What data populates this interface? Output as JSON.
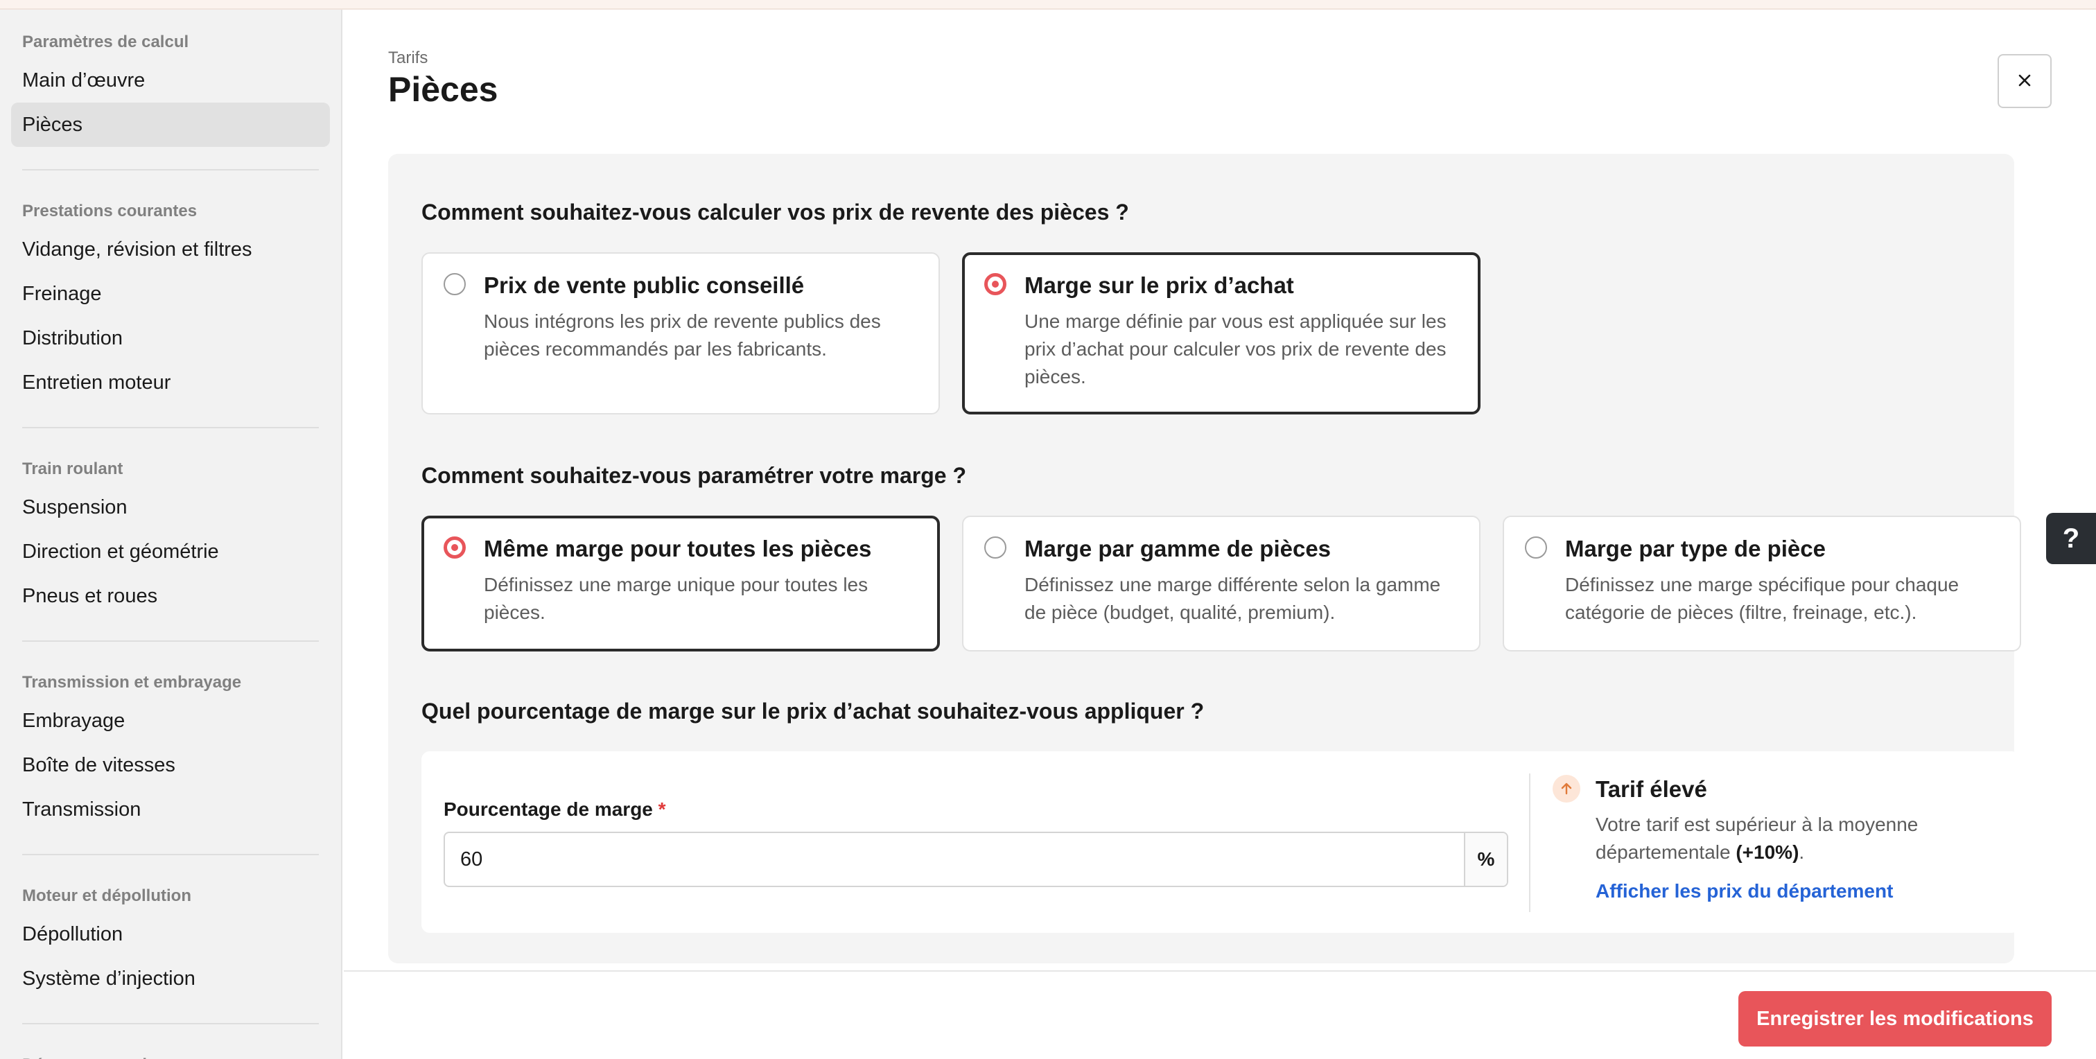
{
  "sidebar": {
    "groups": [
      {
        "title": "Paramètres de calcul",
        "items": [
          "Main d’œuvre",
          "Pièces"
        ]
      },
      {
        "title": "Prestations courantes",
        "items": [
          "Vidange, révision et filtres",
          "Freinage",
          "Distribution",
          "Entretien moteur"
        ]
      },
      {
        "title": "Train roulant",
        "items": [
          "Suspension",
          "Direction et géométrie",
          "Pneus et roues"
        ]
      },
      {
        "title": "Transmission et embrayage",
        "items": [
          "Embrayage",
          "Boîte de vitesses",
          "Transmission"
        ]
      },
      {
        "title": "Moteur et dépollution",
        "items": [
          "Dépollution",
          "Système d’injection"
        ]
      },
      {
        "title": "Démarrage et charge",
        "items": []
      }
    ],
    "active_item": "Pièces"
  },
  "header": {
    "breadcrumb": "Tarifs",
    "title": "Pièces",
    "close_icon": "close-icon"
  },
  "pricing": {
    "question": "Comment souhaitez-vous calculer vos prix de revente des pièces ?",
    "options": [
      {
        "title": "Prix de vente public conseillé",
        "desc": "Nous intégrons les prix de revente publics des pièces recommandés par les fabricants.",
        "selected": false
      },
      {
        "title": "Marge sur le prix d’achat",
        "desc": "Une marge définie par vous est appliquée sur les prix d’achat pour calculer vos prix de revente des pièces.",
        "selected": true
      }
    ]
  },
  "margin_mode": {
    "question": "Comment souhaitez-vous paramétrer votre marge ?",
    "options": [
      {
        "title": "Même marge pour toutes les pièces",
        "desc": "Définissez une marge unique pour toutes les pièces.",
        "selected": true
      },
      {
        "title": "Marge par gamme de pièces",
        "desc": "Définissez une marge différente selon la gamme de pièce (budget, qualité, premium).",
        "selected": false
      },
      {
        "title": "Marge par type de pièce",
        "desc": "Définissez une marge spécifique pour chaque catégorie de pièces (filtre, freinage, etc.).",
        "selected": false
      }
    ]
  },
  "margin_value": {
    "question": "Quel pourcentage de marge sur le prix d’achat souhaitez-vous appliquer ?",
    "label": "Pourcentage de marge",
    "required_mark": "*",
    "value": "60",
    "suffix": "%"
  },
  "alert": {
    "icon": "arrow-up-icon",
    "title": "Tarif élevé",
    "text_before": "Votre tarif est supérieur à la moyenne départementale",
    "text_bold": "(+10%)",
    "text_after": ".",
    "link": "Afficher les prix du département"
  },
  "footer": {
    "save_label": "Enregistrer les modifications"
  },
  "help": {
    "label": "?"
  },
  "colors": {
    "accent": "#e8555a",
    "link": "#2563d6",
    "sidebar_bg": "#f2f2f2",
    "panel_bg": "#f4f4f4"
  }
}
